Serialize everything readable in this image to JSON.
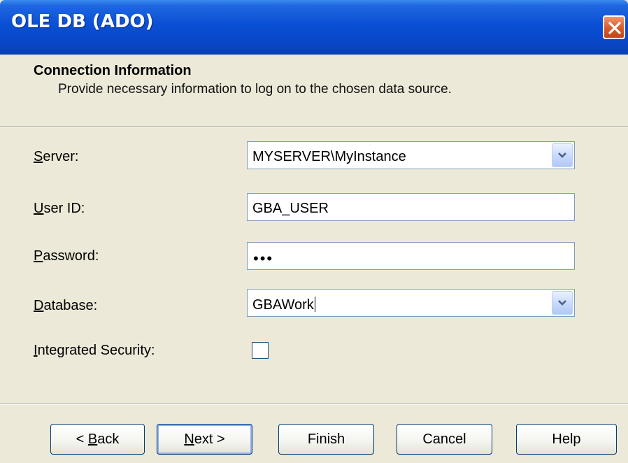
{
  "window": {
    "title": "OLE DB (ADO)",
    "close_icon": "close-icon"
  },
  "header": {
    "title": "Connection Information",
    "description": "Provide necessary information to log on to the chosen data source."
  },
  "form": {
    "server": {
      "label_key": "S",
      "label_rest": "erver:",
      "value": "MYSERVER\\MyInstance"
    },
    "user_id": {
      "label_key": "U",
      "label_rest": "ser ID:",
      "value": "GBA_USER"
    },
    "password": {
      "label_key": "P",
      "label_rest": "assword:",
      "masked_value": "•••"
    },
    "database": {
      "label_key": "D",
      "label_rest": "atabase:",
      "value": "GBAWork"
    },
    "integrated_security": {
      "label_key": "I",
      "label_rest": "ntegrated Security:",
      "checked": false
    }
  },
  "buttons": {
    "back": {
      "prefix": "< ",
      "key": "B",
      "rest": "ack"
    },
    "next": {
      "key": "N",
      "rest": "ext >"
    },
    "finish": "Finish",
    "cancel": "Cancel",
    "help": "Help"
  },
  "colors": {
    "titlebar": "#0a4fd4",
    "dialog_bg": "#ece9d8",
    "close_button": "#d85a2c"
  }
}
